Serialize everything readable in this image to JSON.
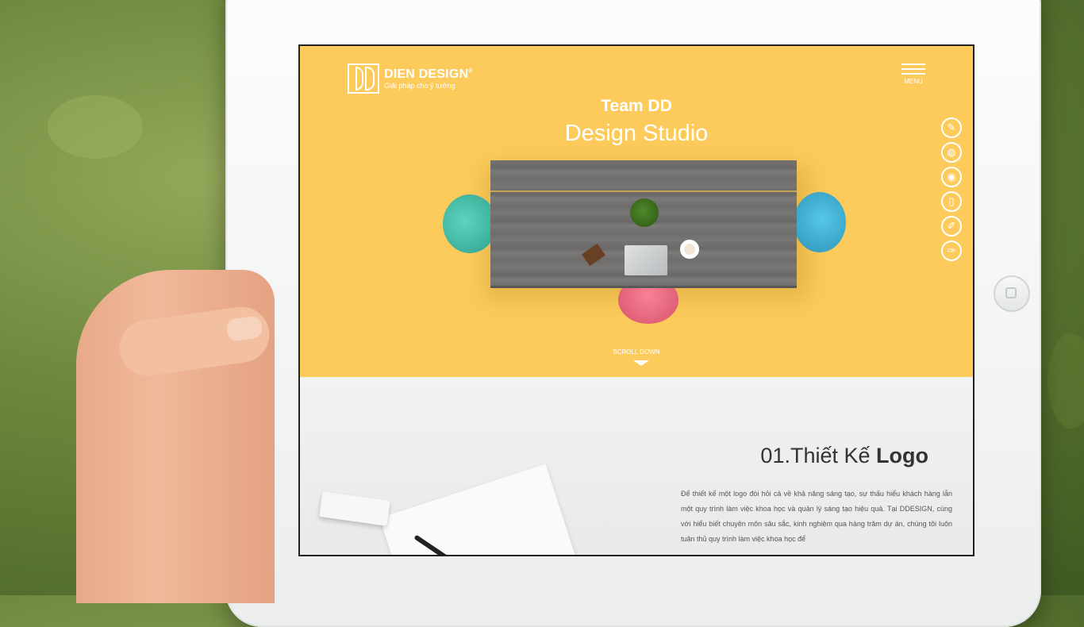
{
  "logo": {
    "name": "DIEN DESIGN",
    "registered": "®",
    "tagline": "Giải pháp cho ý tưởng"
  },
  "menu": {
    "label": "MENU"
  },
  "hero": {
    "team": "Team DD",
    "studio": "Design Studio",
    "scroll_label": "SCROLL DOWN"
  },
  "side_icons": [
    {
      "name": "edit-icon",
      "glyph": "✎"
    },
    {
      "name": "globe-icon",
      "glyph": "◍"
    },
    {
      "name": "camera-icon",
      "glyph": "◉"
    },
    {
      "name": "mobile-icon",
      "glyph": "▯"
    },
    {
      "name": "design-icon",
      "glyph": "✐"
    },
    {
      "name": "brush-icon",
      "glyph": "✑"
    }
  ],
  "section": {
    "number_title": "01.Thiết Kế ",
    "title_bold": "Logo",
    "body": "Để thiết kế một logo đòi hỏi cả về khả năng sáng tạo, sự thấu hiểu khách hàng lẫn một quy trình làm việc khoa học và quản lý sáng tạo hiệu quả. Tại DDESIGN, cùng với hiểu biết chuyên môn sâu sắc, kinh nghiệm qua hàng trăm dự án, chúng tôi luôn tuân thủ quy trình làm việc khoa học để"
  }
}
